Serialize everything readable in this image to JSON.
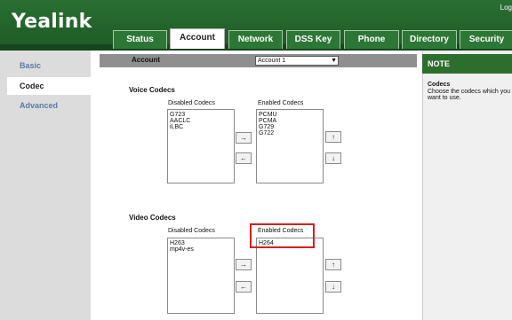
{
  "header": {
    "logo": "Yealink",
    "logout": "Log"
  },
  "tabs": [
    {
      "label": "Status"
    },
    {
      "label": "Account",
      "active": true
    },
    {
      "label": "Network"
    },
    {
      "label": "DSS Key"
    },
    {
      "label": "Phone"
    },
    {
      "label": "Directory"
    },
    {
      "label": "Security"
    }
  ],
  "sidebar": {
    "items": [
      {
        "label": "Basic"
      },
      {
        "label": "Codec",
        "active": true
      },
      {
        "label": "Advanced"
      }
    ]
  },
  "account": {
    "label": "Account",
    "selected": "Account 1"
  },
  "voice": {
    "title": "Voice Codecs",
    "disabled_label": "Disabled Codecs",
    "enabled_label": "Enabled Codecs",
    "disabled": [
      "G723",
      "AACLC",
      "iLBC"
    ],
    "enabled": [
      "PCMU",
      "PCMA",
      "G729",
      "G722"
    ]
  },
  "video": {
    "title": "Video Codecs",
    "disabled_label": "Disabled Codecs",
    "enabled_label": "Enabled Codecs",
    "disabled": [
      "H263",
      "mp4v-es"
    ],
    "enabled": [
      "H264"
    ]
  },
  "buttons": {
    "move_right": "→",
    "move_left": "←",
    "up": "↑",
    "down": "↓"
  },
  "note": {
    "header": "NOTE",
    "title": "Codecs",
    "text": "Choose the codecs which you want to use."
  },
  "colors": {
    "header_green": "#2a6f32",
    "highlight_red": "#d8201f",
    "nav_link": "#5b7aa5"
  }
}
